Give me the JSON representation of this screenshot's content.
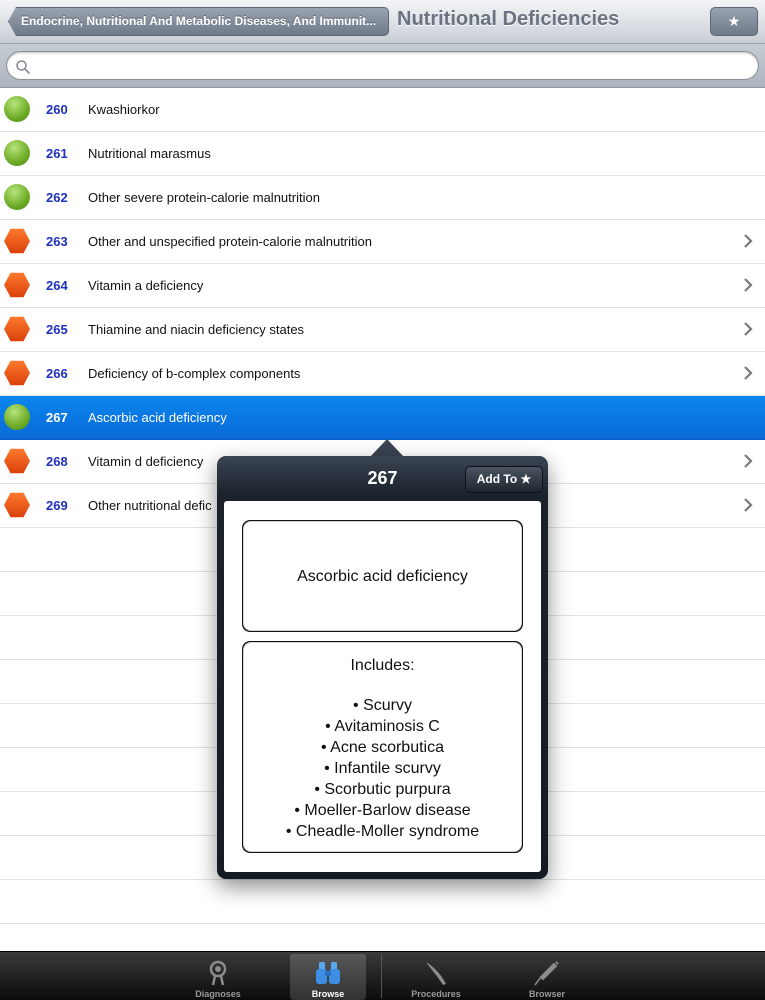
{
  "nav": {
    "back_label": "Endocrine, Nutritional And Metabolic Diseases, And Immunit...",
    "title": "Nutritional Deficiencies",
    "star_label": "★"
  },
  "search": {
    "placeholder": ""
  },
  "rows": [
    {
      "code": "260",
      "label": "Kwashiorkor",
      "shape": "circle",
      "chevron": false
    },
    {
      "code": "261",
      "label": "Nutritional marasmus",
      "shape": "circle",
      "chevron": false
    },
    {
      "code": "262",
      "label": "Other severe protein-calorie malnutrition",
      "shape": "circle",
      "chevron": false
    },
    {
      "code": "263",
      "label": "Other and unspecified protein-calorie malnutrition",
      "shape": "hexagon",
      "chevron": true
    },
    {
      "code": "264",
      "label": "Vitamin a deficiency",
      "shape": "hexagon",
      "chevron": true
    },
    {
      "code": "265",
      "label": "Thiamine and niacin deficiency states",
      "shape": "hexagon",
      "chevron": true
    },
    {
      "code": "266",
      "label": "Deficiency of b-complex components",
      "shape": "hexagon",
      "chevron": true
    },
    {
      "code": "267",
      "label": "Ascorbic acid deficiency",
      "shape": "circle",
      "chevron": false,
      "selected": true
    },
    {
      "code": "268",
      "label": "Vitamin d deficiency",
      "shape": "hexagon",
      "chevron": true
    },
    {
      "code": "269",
      "label": "Other nutritional defic",
      "shape": "hexagon",
      "chevron": true
    }
  ],
  "colors": {
    "circle": "#6dac26",
    "hexagon": "#e5510f",
    "selected": "#0a7ae2",
    "code": "#1f2fbf"
  },
  "popover": {
    "title": "267",
    "add_to_label": "Add To ★",
    "description": "Ascorbic acid deficiency",
    "includes_heading": "Includes:",
    "includes": [
      "• Scurvy",
      "• Avitaminosis C",
      "• Acne scorbutica",
      "• Infantile scurvy",
      "• Scorbutic purpura",
      "• Moeller-Barlow disease",
      "• Cheadle-Moller syndrome"
    ]
  },
  "tabs": [
    {
      "label": "Diagnoses",
      "icon": "stethoscope-icon",
      "active": false
    },
    {
      "label": "Browse",
      "icon": "binoculars-icon",
      "active": true
    },
    {
      "label": "Procedures",
      "icon": "scalpel-icon",
      "active": false
    },
    {
      "label": "Browser",
      "icon": "syringe-icon",
      "active": false
    }
  ]
}
